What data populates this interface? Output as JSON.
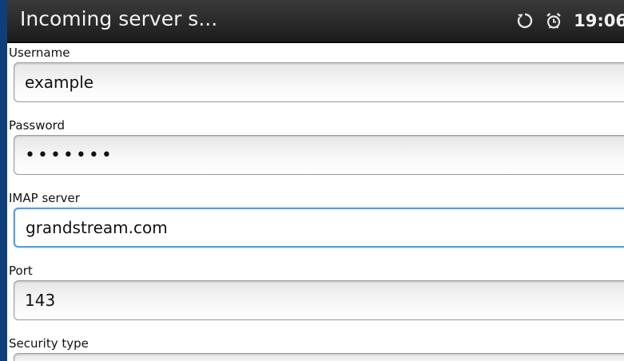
{
  "statusbar": {
    "title": "Incoming server s...",
    "sync_icon": "sync-icon",
    "alarm_icon": "alarm-clock-icon",
    "time": "19:06"
  },
  "form": {
    "username": {
      "label": "Username",
      "value": "example"
    },
    "password": {
      "label": "Password",
      "value": "•••••••"
    },
    "imap_server": {
      "label": "IMAP server",
      "value": "grandstream.com"
    },
    "port": {
      "label": "Port",
      "value": "143"
    },
    "security_type": {
      "label": "Security type"
    }
  },
  "colors": {
    "statusbar_bg": "#2a2a2a",
    "left_edge": "#0f3f7a",
    "focus_border": "#5b9dd9"
  }
}
